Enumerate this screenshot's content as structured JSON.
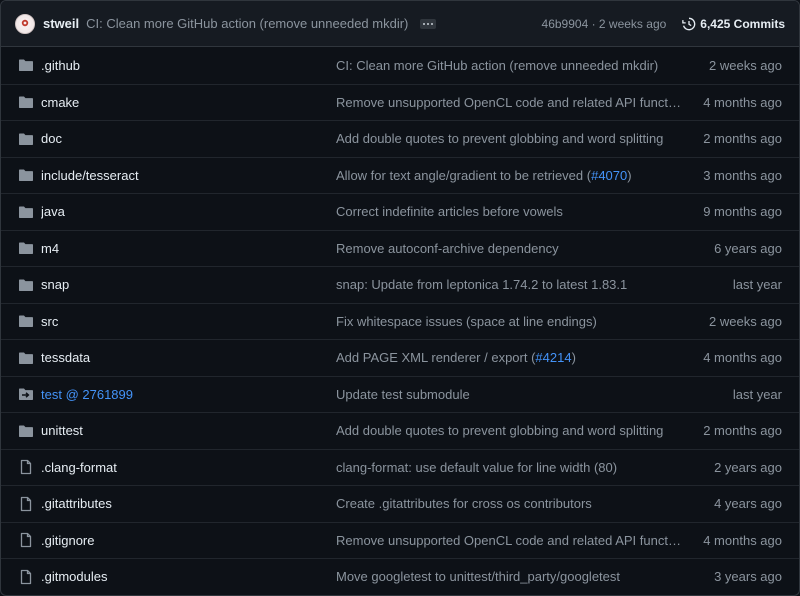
{
  "header": {
    "author": "stweil",
    "commit_message": "CI: Clean more GitHub action (remove unneeded mkdir)",
    "sha_and_date": "46b9904 · 2 weeks ago",
    "commit_count": "6,425 Commits"
  },
  "colors": {
    "folder": "#8b949e",
    "link": "#4493f8",
    "text": "#e6edf3",
    "muted": "#8b949e"
  },
  "files": [
    {
      "icon": "folder-icon",
      "name": ".github",
      "msg_pre": "CI: Clean more GitHub action (remove unneeded mkdir)",
      "pr": "",
      "msg_post": "",
      "age": "2 weeks ago"
    },
    {
      "icon": "folder-icon",
      "name": "cmake",
      "msg_pre": "Remove unsupported OpenCL code and related API functions",
      "pr": "",
      "msg_post": "",
      "age": "4 months ago"
    },
    {
      "icon": "folder-icon",
      "name": "doc",
      "msg_pre": "Add double quotes to prevent globbing and word splitting",
      "pr": "",
      "msg_post": "",
      "age": "2 months ago"
    },
    {
      "icon": "folder-icon",
      "name": "include/tesseract",
      "msg_pre": "Allow for text angle/gradient to be retrieved (",
      "pr": "#4070",
      "msg_post": ")",
      "age": "3 months ago"
    },
    {
      "icon": "folder-icon",
      "name": "java",
      "msg_pre": "Correct indefinite articles before vowels",
      "pr": "",
      "msg_post": "",
      "age": "9 months ago"
    },
    {
      "icon": "folder-icon",
      "name": "m4",
      "msg_pre": "Remove autoconf-archive dependency",
      "pr": "",
      "msg_post": "",
      "age": "6 years ago"
    },
    {
      "icon": "folder-icon",
      "name": "snap",
      "msg_pre": "snap: Update from leptonica 1.74.2 to latest 1.83.1",
      "pr": "",
      "msg_post": "",
      "age": "last year"
    },
    {
      "icon": "folder-icon",
      "name": "src",
      "msg_pre": "Fix whitespace issues (space at line endings)",
      "pr": "",
      "msg_post": "",
      "age": "2 weeks ago"
    },
    {
      "icon": "folder-icon",
      "name": "tessdata",
      "msg_pre": "Add PAGE XML renderer / export (",
      "pr": "#4214",
      "msg_post": ")",
      "age": "4 months ago"
    },
    {
      "icon": "submodule-icon",
      "name": "test @ 2761899",
      "msg_pre": "Update test submodule",
      "pr": "",
      "msg_post": "",
      "age": "last year"
    },
    {
      "icon": "folder-icon",
      "name": "unittest",
      "msg_pre": "Add double quotes to prevent globbing and word splitting",
      "pr": "",
      "msg_post": "",
      "age": "2 months ago"
    },
    {
      "icon": "file-icon",
      "name": ".clang-format",
      "msg_pre": "clang-format: use default value for line width (80)",
      "pr": "",
      "msg_post": "",
      "age": "2 years ago"
    },
    {
      "icon": "file-icon",
      "name": ".gitattributes",
      "msg_pre": "Create .gitattributes for cross os contributors",
      "pr": "",
      "msg_post": "",
      "age": "4 years ago"
    },
    {
      "icon": "file-icon",
      "name": ".gitignore",
      "msg_pre": "Remove unsupported OpenCL code and related API functions",
      "pr": "",
      "msg_post": "",
      "age": "4 months ago"
    },
    {
      "icon": "file-icon",
      "name": ".gitmodules",
      "msg_pre": "Move googletest to unittest/third_party/googletest",
      "pr": "",
      "msg_post": "",
      "age": "3 years ago"
    }
  ]
}
